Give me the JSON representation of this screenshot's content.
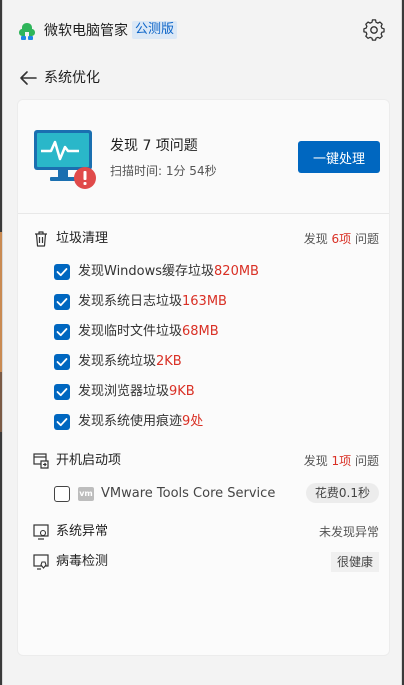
{
  "app": {
    "title": "微软电脑管家",
    "beta_badge": "公测版"
  },
  "nav": {
    "title": "系统优化"
  },
  "summary": {
    "headline": "发现 7 项问题",
    "scan_time": "扫描时间: 1分 54秒",
    "fix_button": "一键处理"
  },
  "junk": {
    "label": "垃圾清理",
    "found_prefix": "发现 ",
    "found_count": "6项",
    "found_suffix": " 问题",
    "items": [
      {
        "prefix": "发现Windows缓存垃圾",
        "value": "820MB",
        "checked": true
      },
      {
        "prefix": "发现系统日志垃圾",
        "value": "163MB",
        "checked": true
      },
      {
        "prefix": "发现临时文件垃圾",
        "value": "68MB",
        "checked": true
      },
      {
        "prefix": "发现系统垃圾",
        "value": "2KB",
        "checked": true
      },
      {
        "prefix": "发现浏览器垃圾",
        "value": "9KB",
        "checked": true
      },
      {
        "prefix": "发现系统使用痕迹",
        "value": "9处",
        "checked": true
      }
    ]
  },
  "startup": {
    "label": "开机启动项",
    "found_prefix": "发现 ",
    "found_count": "1项",
    "found_suffix": " 问题",
    "items": [
      {
        "icon_text": "vm",
        "name": "VMware Tools Core Service",
        "time": "花费0.1秒",
        "checked": false
      }
    ]
  },
  "system": {
    "label": "系统异常",
    "status": "未发现异常"
  },
  "virus": {
    "label": "病毒检测",
    "status": "很健康"
  },
  "colors": {
    "accent": "#0067c0",
    "alert": "#d93025",
    "monitor_screen": "#2ab7c9"
  }
}
